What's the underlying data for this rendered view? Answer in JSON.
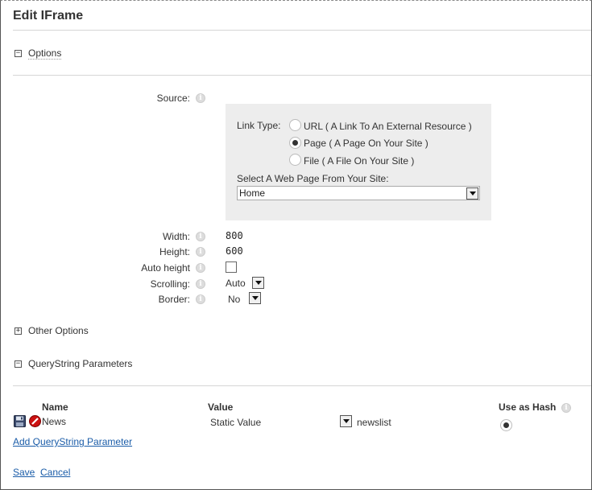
{
  "page": {
    "title": "Edit IFrame"
  },
  "options_section": {
    "label": "Options",
    "toggle": "−"
  },
  "source": {
    "label": "Source:",
    "link_type_label": "Link Type:",
    "link_types": [
      {
        "label": "URL ( A Link To An External Resource )",
        "checked": false
      },
      {
        "label": "Page ( A Page On Your Site )",
        "checked": true
      },
      {
        "label": "File ( A File On Your Site )",
        "checked": false
      }
    ],
    "select_page_label": "Select A Web Page From Your Site:",
    "selected_page": "Home"
  },
  "fields": {
    "width": {
      "label": "Width:",
      "value": "800"
    },
    "height": {
      "label": "Height:",
      "value": "600"
    },
    "auto_height": {
      "label": "Auto height",
      "checked": false
    },
    "scrolling": {
      "label": "Scrolling:",
      "value": "Auto"
    },
    "border": {
      "label": "Border:",
      "value": "No"
    }
  },
  "other_options": {
    "label": "Other Options",
    "toggle": "+"
  },
  "querystring": {
    "label": "QueryString Parameters",
    "toggle": "−"
  },
  "qs_table": {
    "headers": {
      "name": "Name",
      "value": "Value",
      "use_as_hash": "Use as Hash"
    },
    "row": {
      "name": "News",
      "value_type": "Static Value",
      "value": "newslist",
      "use_as_hash": true
    }
  },
  "add_param_link": "Add QueryString Parameter",
  "actions": {
    "save": "Save",
    "cancel": "Cancel"
  },
  "icons": {
    "info": "i"
  },
  "colors": {
    "panel_bg": "#ededed",
    "link": "#1a5ca8",
    "delete_red": "#cc1111"
  }
}
